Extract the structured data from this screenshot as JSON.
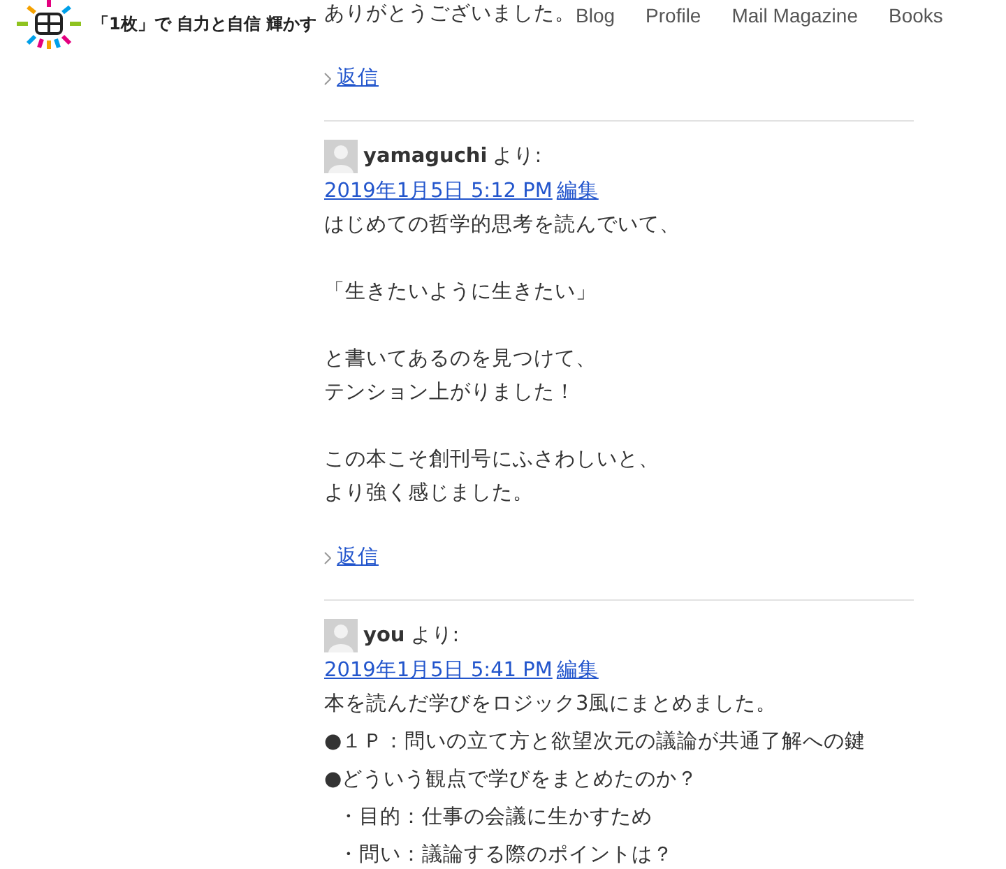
{
  "header": {
    "site_title": "「1枚」で 自力と自信 輝かす",
    "nav": [
      "Blog",
      "Profile",
      "Mail Magazine",
      "Books"
    ]
  },
  "comments": [
    {
      "body": [
        {
          "kind": "para",
          "lines": [
            "ありがとうございました。"
          ]
        }
      ],
      "reply": "返信"
    },
    {
      "author": "yamaguchi",
      "by": "より:",
      "date": "2019年1月5日 5:12 PM",
      "edit": "編集",
      "body": [
        {
          "kind": "para",
          "lines": [
            "はじめての哲学的思考を読んでいて、"
          ]
        },
        {
          "kind": "para",
          "lines": [
            "「生きたいように生きたい」"
          ]
        },
        {
          "kind": "para",
          "lines": [
            "と書いてあるのを見つけて、",
            "テンション上がりました！"
          ]
        },
        {
          "kind": "para",
          "lines": [
            "この本こそ創刊号にふさわしいと、",
            "より強く感じました。"
          ]
        }
      ],
      "reply": "返信"
    },
    {
      "author": "you",
      "by": "より:",
      "date": "2019年1月5日 5:41 PM",
      "edit": "編集",
      "body": [
        {
          "kind": "line",
          "text": "本を読んだ学びをロジック3風にまとめました。"
        },
        {
          "kind": "line",
          "text": "●１Ｐ：問いの立て方と欲望次元の議論が共通了解への鍵"
        },
        {
          "kind": "line",
          "text": "●どういう観点で学びをまとめたのか？"
        },
        {
          "kind": "sub",
          "text": "・目的：仕事の会議に生かすため"
        },
        {
          "kind": "sub",
          "text": "・問い：議論する際のポイントは？"
        }
      ]
    }
  ]
}
